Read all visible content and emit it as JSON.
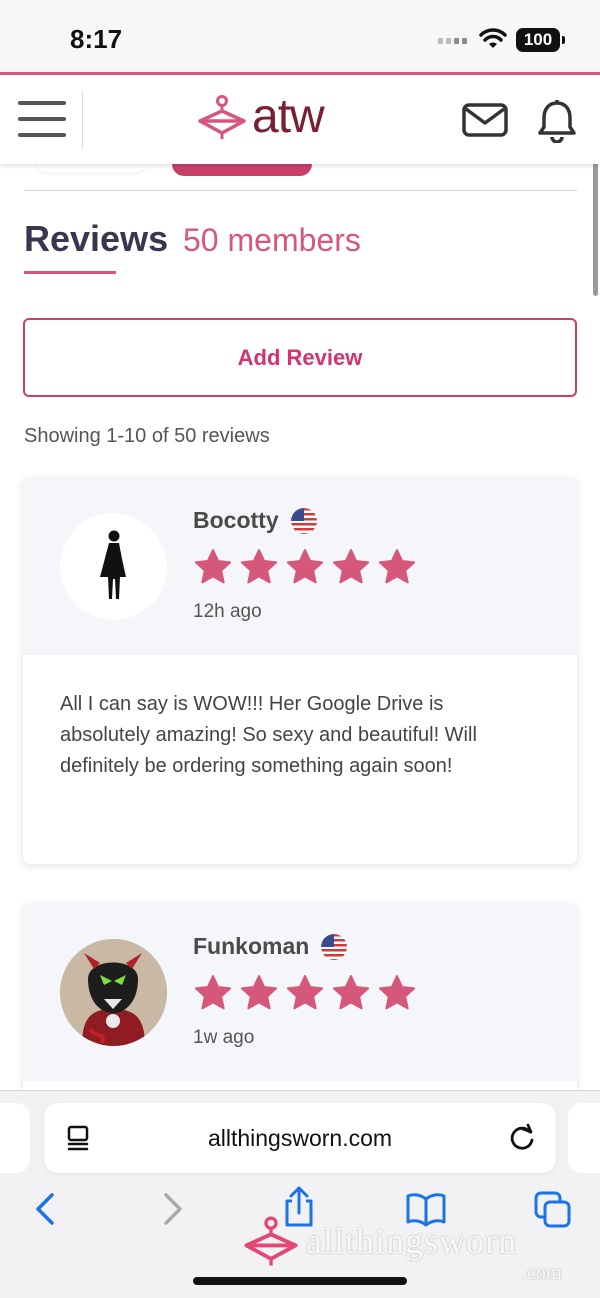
{
  "status_bar": {
    "time": "8:17",
    "battery": "100"
  },
  "header": {
    "logo_text": "atw"
  },
  "reviews": {
    "title": "Reviews",
    "count_label": "50 members",
    "add_button": "Add Review",
    "showing": "Showing 1-10 of 50 reviews",
    "items": [
      {
        "name": "Bocotty",
        "rating": 5,
        "time": "12h ago",
        "text": "All I can say is WOW!!! Her Google Drive is absolutely amazing! So sexy and beautiful! Will definitely be ordering something again soon!"
      },
      {
        "name": "Funkoman",
        "rating": 5,
        "time": "1w ago",
        "text": ""
      }
    ]
  },
  "browser": {
    "url": "allthingsworn.com"
  },
  "watermark": {
    "text": "allthingsworn",
    "suffix": ".com"
  },
  "colors": {
    "accent": "#d6577c",
    "brand_dark": "#7a1f33",
    "button_text": "#d6336c",
    "ios_blue": "#1a73e8"
  }
}
